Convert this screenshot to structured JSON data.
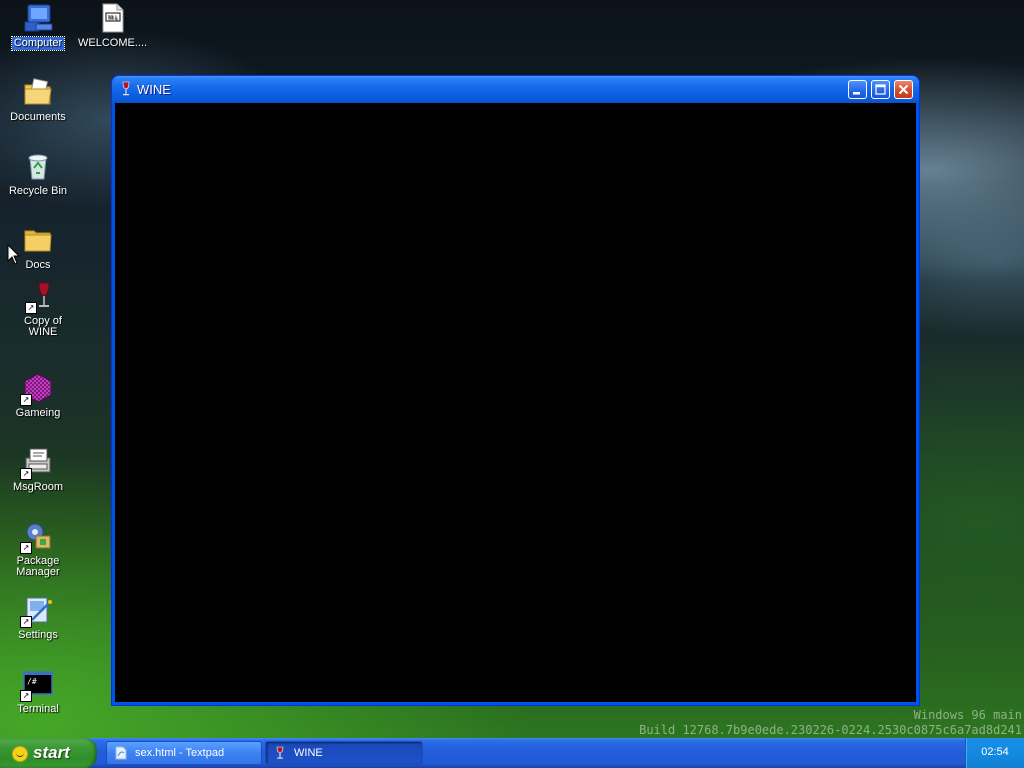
{
  "desktop": {
    "icons": [
      {
        "label": "Computer",
        "icon": "computer-icon",
        "selected": true
      },
      {
        "label": "WELCOME....",
        "icon": "document-icon"
      },
      {
        "label": "Documents",
        "icon": "documents-folder-icon"
      },
      {
        "label": "Recycle Bin",
        "icon": "recycle-bin-icon"
      },
      {
        "label": "Docs",
        "icon": "folder-icon"
      },
      {
        "label": "Copy of WINE",
        "icon": "wine-icon"
      },
      {
        "label": "Gameing",
        "icon": "game-icon"
      },
      {
        "label": "MsgRoom",
        "icon": "msgroom-icon"
      },
      {
        "label": "Package Manager",
        "icon": "package-manager-icon"
      },
      {
        "label": "Settings",
        "icon": "settings-icon"
      },
      {
        "label": "Terminal",
        "icon": "terminal-icon"
      }
    ]
  },
  "window": {
    "title": "WINE",
    "icon": "wine-icon",
    "buttons": [
      "minimize",
      "maximize",
      "close"
    ]
  },
  "watermark": {
    "line1": "Windows 96 main",
    "line2": "Build 12768.7b9e0ede.230226-0224.2530c0875c6a7ad8d241"
  },
  "taskbar": {
    "start_label": "start",
    "tasks": [
      {
        "label": "sex.html - Textpad",
        "icon": "textpad-icon",
        "active": false
      },
      {
        "label": "WINE",
        "icon": "wine-icon",
        "active": true
      }
    ],
    "clock": "02:54"
  },
  "colors": {
    "titlebar": "#0c5fe2",
    "taskbar": "#245edb",
    "start_button": "#3c9a36",
    "window_client": "#000000"
  }
}
